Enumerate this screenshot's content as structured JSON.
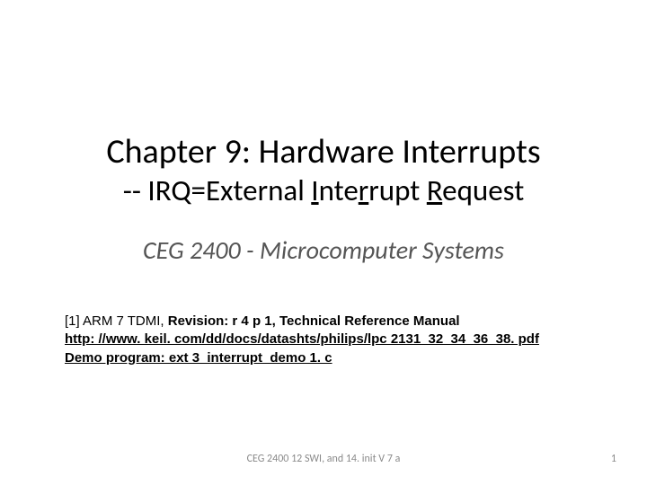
{
  "title": {
    "line1": "Chapter 9: Hardware Interrupts",
    "dash": "--",
    "prefix": "IRQ=External ",
    "i_letter": "I",
    "nte": "nte",
    "r_letter": "r",
    "rupt": "rupt ",
    "r_cap": "R",
    "equest": "equest"
  },
  "subtitle": "CEG 2400 - Microcomputer Systems",
  "refs": {
    "cite_prefix": "[1] ARM 7 TDMI, ",
    "cite_bold": "Revision: r 4 p 1, Technical Reference Manual",
    "url": "http: //www. keil. com/dd/docs/datashts/philips/lpc 2131_32_34_36_38. pdf",
    "demo": "Demo program: ext 3_interrupt_demo 1. c"
  },
  "footer": {
    "center": "CEG 2400 12 SWI, and 14. init V 7 a",
    "page": "1"
  }
}
